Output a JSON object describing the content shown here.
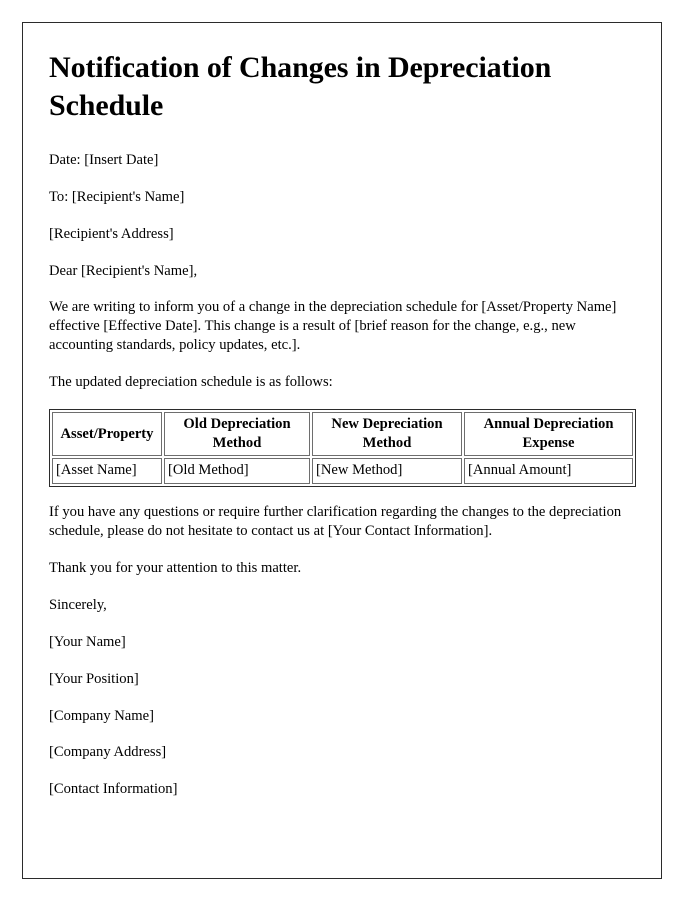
{
  "document": {
    "title": "Notification of Changes in Depreciation Schedule",
    "date_line": "Date: [Insert Date]",
    "to_line": "To: [Recipient's Name]",
    "address_line": "[Recipient's Address]",
    "salutation": "Dear [Recipient's Name],",
    "intro_paragraph": "We are writing to inform you of a change in the depreciation schedule for [Asset/Property Name] effective [Effective Date]. This change is a result of [brief reason for the change, e.g., new accounting standards, policy updates, etc.].",
    "table_lead_in": "The updated depreciation schedule is as follows:",
    "closing_paragraph": "If you have any questions or require further clarification regarding the changes to the depreciation schedule, please do not hesitate to contact us at [Your Contact Information].",
    "thanks_paragraph": "Thank you for your attention to this matter.",
    "sign_off": "Sincerely,",
    "signature_block": [
      "[Your Name]",
      "[Your Position]",
      "[Company Name]",
      "[Company Address]",
      "[Contact Information]"
    ]
  },
  "schedule_table": {
    "headers": [
      "Asset/Property",
      "Old Depreciation Method",
      "New Depreciation Method",
      "Annual Depreciation Expense"
    ],
    "rows": [
      [
        "[Asset Name]",
        "[Old Method]",
        "[New Method]",
        "[Annual Amount]"
      ]
    ]
  },
  "style": {
    "page_border_color": "#2b2b2b",
    "text_color": "#000000",
    "background_color": "#ffffff",
    "table_cell_border_color": "#6e6e6e"
  }
}
